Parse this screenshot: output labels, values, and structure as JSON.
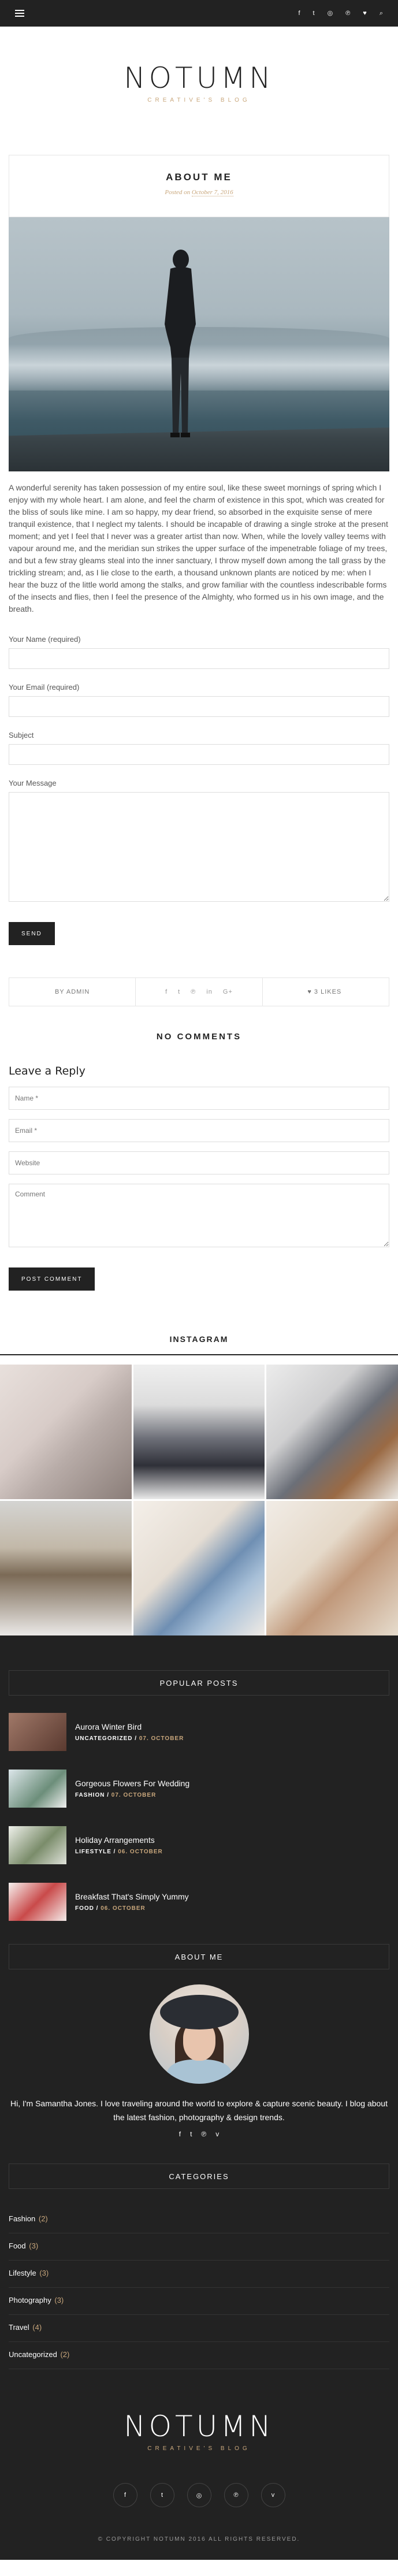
{
  "topbar": {
    "social_icons": [
      "facebook-icon",
      "twitter-icon",
      "instagram-icon",
      "pinterest-icon",
      "heart-icon",
      "search-icon"
    ],
    "glyphs": [
      "f",
      "t",
      "◎",
      "℗",
      "♥",
      "⌕"
    ]
  },
  "site": {
    "logo": "NOTUMN",
    "tagline": "CREATIVE'S BLOG"
  },
  "post": {
    "title": "ABOUT ME",
    "date_prefix": "Posted on",
    "date": "October 7, 2016",
    "body": "A wonderful serenity has taken possession of my entire soul, like these sweet mornings of spring which I enjoy with my whole heart. I am alone, and feel the charm of existence in this spot, which was created for the bliss of souls like mine. I am so happy, my dear friend, so absorbed in the exquisite sense of mere tranquil existence, that I neglect my talents. I should be incapable of drawing a single stroke at the present moment; and yet I feel that I never was a greater artist than now. When, while the lovely valley teems with vapour around me, and the meridian sun strikes the upper surface of the impenetrable foliage of my trees, and but a few stray gleams steal into the inner sanctuary, I throw myself down among the tall grass by the trickling stream; and, as I lie close to the earth, a thousand unknown plants are noticed by me: when I hear the buzz of the little world among the stalks, and grow familiar with the countless indescribable forms of the insects and flies, then I feel the presence of the Almighty, who formed us in his own image, and the breath."
  },
  "contact_form": {
    "name_label": "Your Name (required)",
    "email_label": "Your Email (required)",
    "subject_label": "Subject",
    "message_label": "Your Message",
    "send_label": "SEND"
  },
  "meta_bar": {
    "author": "BY ADMIN",
    "share_glyphs": [
      "f",
      "t",
      "℗",
      "in",
      "G+"
    ],
    "likes": "3 LIKES",
    "heart": "♥"
  },
  "comments": {
    "heading": "NO COMMENTS",
    "reply_heading": "Leave a Reply",
    "name_placeholder": "Name *",
    "email_placeholder": "Email *",
    "website_placeholder": "Website",
    "comment_placeholder": "Comment",
    "submit_label": "POST COMMENT"
  },
  "instagram": {
    "title": "INSTAGRAM"
  },
  "popular_posts": {
    "title": "POPULAR POSTS",
    "items": [
      {
        "title": "Aurora Winter Bird",
        "category": "UNCATEGORIZED",
        "date": "07. OCTOBER",
        "thumb_color": "#6b4a40"
      },
      {
        "title": "Gorgeous Flowers For Wedding",
        "category": "FASHION",
        "date": "07. OCTOBER",
        "thumb_color": "#8aa2ad"
      },
      {
        "title": "Holiday Arrangements",
        "category": "LIFESTYLE",
        "date": "06. OCTOBER",
        "thumb_color": "#cfd3cc"
      },
      {
        "title": "Breakfast That's Simply Yummy",
        "category": "FOOD",
        "date": "06. OCTOBER",
        "thumb_color": "#e8dede"
      }
    ]
  },
  "about_widget": {
    "title": "ABOUT ME",
    "text": "Hi, I'm Samantha Jones. I love traveling around the world to explore & capture scenic beauty. I blog about the latest fashion, photography & design trends.",
    "social_glyphs": [
      "f",
      "t",
      "℗",
      "v"
    ]
  },
  "categories": {
    "title": "CATEGORIES",
    "items": [
      {
        "name": "Fashion",
        "count": "(2)"
      },
      {
        "name": "Food",
        "count": "(3)"
      },
      {
        "name": "Lifestyle",
        "count": "(3)"
      },
      {
        "name": "Photography",
        "count": "(3)"
      },
      {
        "name": "Travel",
        "count": "(4)"
      },
      {
        "name": "Uncategorized",
        "count": "(2)"
      }
    ]
  },
  "footer": {
    "logo": "NOTUMN",
    "tagline": "CREATIVE'S BLOG",
    "social_glyphs": [
      "f",
      "t",
      "◎",
      "℗",
      "v"
    ],
    "copyright": "© COPYRIGHT NOTUMN 2016 ALL RIGHTS RESERVED."
  },
  "colors": {
    "accent": "#c9a77c",
    "dark": "#222222"
  }
}
